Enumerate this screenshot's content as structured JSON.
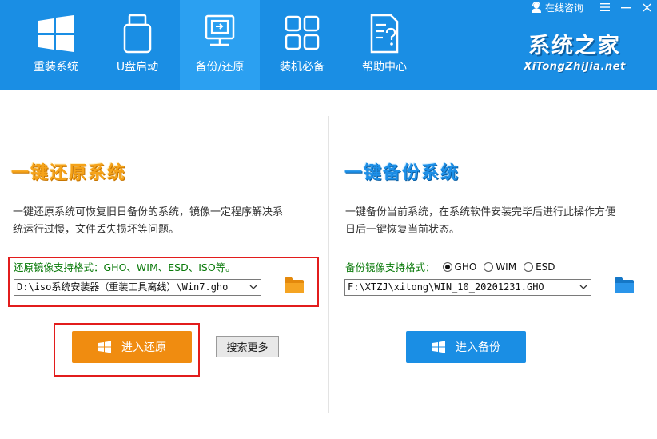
{
  "nav": {
    "items": [
      {
        "label": "重装系统",
        "icon": "windows-logo-icon"
      },
      {
        "label": "U盘启动",
        "icon": "usb-drive-icon"
      },
      {
        "label": "备份/还原",
        "icon": "backup-restore-icon"
      },
      {
        "label": "装机必备",
        "icon": "apps-grid-icon"
      },
      {
        "label": "帮助中心",
        "icon": "help-document-icon"
      }
    ],
    "active": "备份/还原"
  },
  "top_bar": {
    "online_consult": "在线咨询",
    "menu_icon": "menu-icon",
    "minimize_icon": "minimize-icon",
    "close_icon": "close-icon"
  },
  "brand": {
    "name_cn": "系统之家",
    "name_en": "XiTongZhiJia.net"
  },
  "restore": {
    "title": "一键还原系统",
    "description": "一键还原系统可恢复旧日备份的系统，镜像一定程序解决系统运行过慢，文件丢失损坏等问题。",
    "support_label": "还原镜像支持格式：GHO、WIM、ESD、ISO等。",
    "path_value": "D:\\iso系统安装器（重装工具离线）\\Win7.gho",
    "button_label": "进入还原",
    "search_more_label": "搜索更多"
  },
  "backup": {
    "title": "一键备份系统",
    "description": "一键备份当前系统，在系统软件安装完毕后进行此操作方便日后一键恢复当前状态。",
    "support_label": "备份镜像支持格式：",
    "formats": [
      {
        "label": "GHO",
        "checked": true
      },
      {
        "label": "WIM",
        "checked": false
      },
      {
        "label": "ESD",
        "checked": false
      }
    ],
    "path_value": "F:\\XTZJ\\xitong\\WIN_10_20201231.GHO",
    "button_label": "进入备份"
  },
  "colors": {
    "header_bg": "#1a8ee4",
    "nav_active_bg": "#2ba0f1",
    "restore_orange": "#f08c10",
    "backup_blue": "#1a8ee4",
    "highlight_red": "#e21c1c"
  }
}
